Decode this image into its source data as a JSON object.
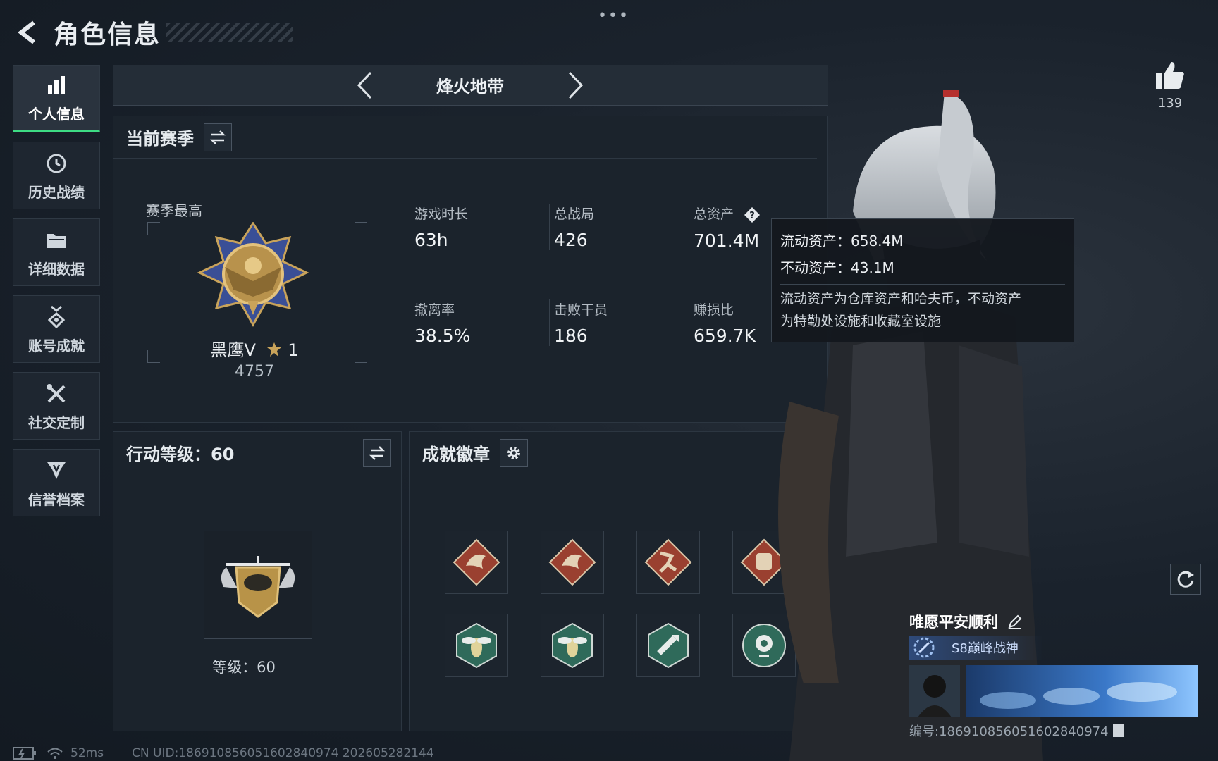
{
  "header": {
    "title": "角色信息",
    "more_dots": "•••"
  },
  "sidebar": {
    "items": [
      {
        "label": "个人信息",
        "icon": "bar-chart-icon",
        "active": true
      },
      {
        "label": "历史战绩",
        "icon": "history-clock-icon",
        "active": false
      },
      {
        "label": "详细数据",
        "icon": "folder-icon",
        "active": false
      },
      {
        "label": "账号成就",
        "icon": "medal-icon",
        "active": false
      },
      {
        "label": "社交定制",
        "icon": "tools-icon",
        "active": false
      },
      {
        "label": "信誉档案",
        "icon": "shield-badge-icon",
        "active": false
      }
    ]
  },
  "mode_nav": {
    "title": "烽火地带"
  },
  "season": {
    "title": "当前赛季",
    "best_label": "赛季最高",
    "rank_name": "黑鹰V",
    "rank_stars": "1",
    "rank_score": "4757",
    "stats": {
      "playtime": {
        "label": "游戏时长",
        "value": "63h"
      },
      "total_matches": {
        "label": "总战局",
        "value": "426"
      },
      "total_assets": {
        "label": "总资产",
        "value": "701.4M"
      },
      "extract_rate": {
        "label": "撤离率",
        "value": "38.5%"
      },
      "kills": {
        "label": "击败干员",
        "value": "186"
      },
      "profit_ratio": {
        "label": "赚损比",
        "value": "659.7K"
      }
    }
  },
  "tooltip": {
    "liquid": "流动资产：658.4M",
    "fixed": "不动资产：43.1M",
    "desc_line1": "流动资产为仓库资产和哈夫币，不动资产",
    "desc_line2": "为特勤处设施和收藏室设施"
  },
  "level": {
    "title": "行动等级：60",
    "level_text": "等级：60"
  },
  "badges": {
    "title": "成就徽章",
    "items": [
      {
        "icon": "dragon-badge-icon",
        "color": "#9a4030"
      },
      {
        "icon": "dragon-badge-icon",
        "color": "#9a4030"
      },
      {
        "icon": "runner-badge-icon",
        "color": "#9a4030"
      },
      {
        "icon": "fist-badge-icon",
        "color": "#9a4030"
      },
      {
        "icon": "wasp-badge-icon",
        "color": "#2f6a5a"
      },
      {
        "icon": "wasp-badge-icon",
        "color": "#2f6a5a"
      },
      {
        "icon": "bullet-badge-icon",
        "color": "#2f6a5a"
      },
      {
        "icon": "flower-badge-icon",
        "color": "#2f6a5a"
      }
    ]
  },
  "character": {
    "likes": "139"
  },
  "player": {
    "name": "唯愿平安顺利",
    "title": "S8巅峰战神",
    "id_text": "编号:186910856051602840974"
  },
  "footer": {
    "ping": "52ms",
    "uid": "CN UID:186910856051602840974 202605282144"
  },
  "colors": {
    "accent_green": "#3ddc84",
    "bg": "#141b24"
  }
}
